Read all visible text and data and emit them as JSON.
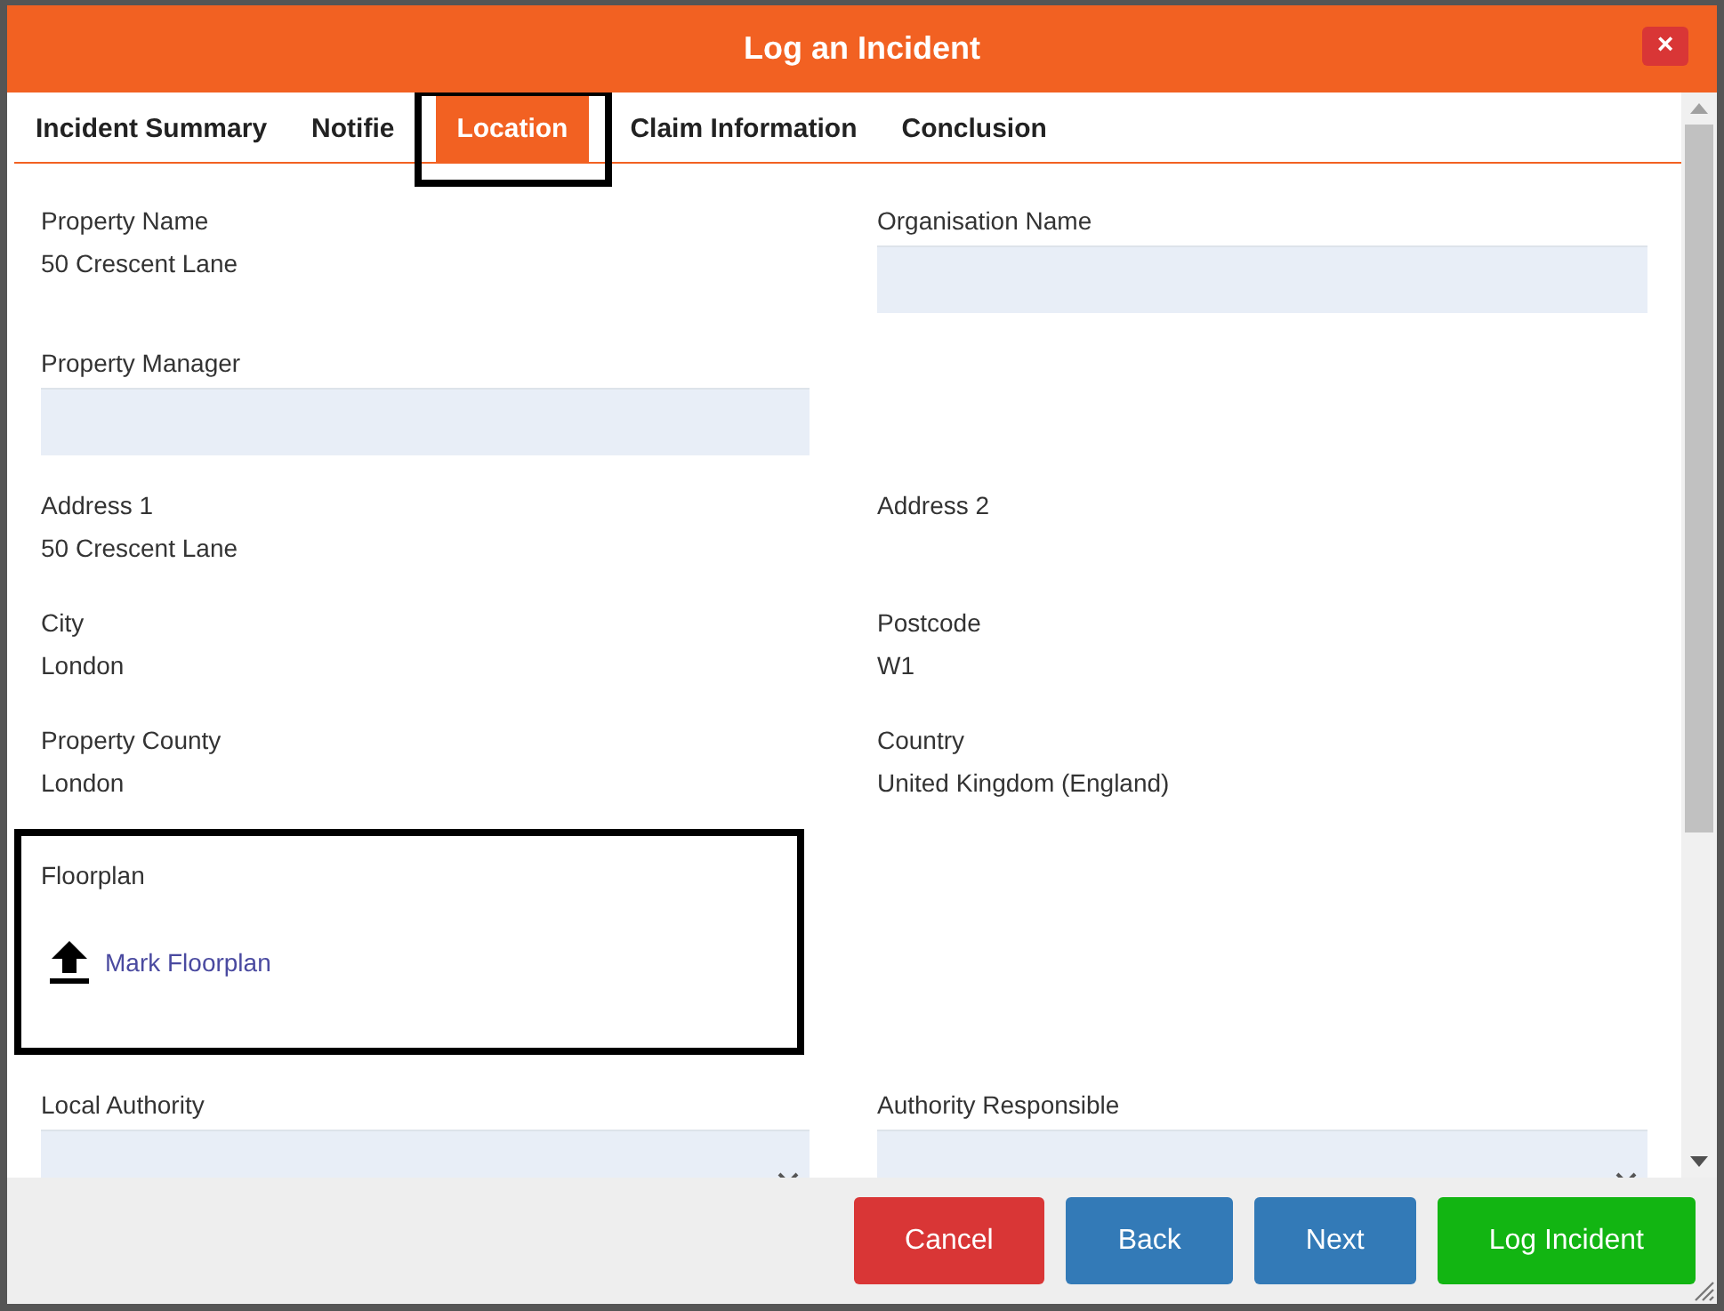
{
  "window": {
    "title": "Log an Incident",
    "close_icon": "×"
  },
  "tabs": [
    {
      "label": "Incident Summary",
      "selected": false,
      "highlighted": false
    },
    {
      "label": "Notifie",
      "selected": false,
      "highlighted": false
    },
    {
      "label": "Location",
      "selected": true,
      "highlighted": true
    },
    {
      "label": "Claim Information",
      "selected": false,
      "highlighted": false
    },
    {
      "label": "Conclusion",
      "selected": false,
      "highlighted": false
    }
  ],
  "rows": [
    {
      "cells": [
        {
          "kind": "text",
          "label": "Property Name",
          "value": "50 Crescent Lane"
        },
        {
          "kind": "input",
          "label": "Organisation Name"
        }
      ]
    },
    {
      "cells": [
        {
          "kind": "input",
          "label": "Property Manager"
        }
      ]
    },
    {
      "cells": [
        {
          "kind": "text",
          "label": "Address 1",
          "value": "50 Crescent Lane"
        },
        {
          "kind": "text",
          "label": "Address 2"
        }
      ]
    },
    {
      "cells": [
        {
          "kind": "text",
          "label": "City",
          "value": "London"
        },
        {
          "kind": "text",
          "label": "Postcode",
          "value": "W1"
        }
      ]
    },
    {
      "cells": [
        {
          "kind": "text",
          "label": "Property County",
          "value": "London"
        },
        {
          "kind": "text",
          "label": "Country",
          "value": "United Kingdom (England)"
        }
      ]
    },
    {
      "cells": [
        {
          "kind": "upload",
          "label": "Floorplan",
          "link": "Mark Floorplan",
          "highlighted": true
        }
      ]
    },
    {
      "cells": [
        {
          "kind": "select",
          "label": "Local Authority"
        },
        {
          "kind": "select",
          "label": "Authority Responsible"
        }
      ]
    }
  ],
  "buttons": [
    {
      "label": "Cancel",
      "kind": "danger"
    },
    {
      "label": "Back",
      "kind": "primary"
    },
    {
      "label": "Next",
      "kind": "primary"
    },
    {
      "label": "Log Incident",
      "kind": "success"
    }
  ]
}
